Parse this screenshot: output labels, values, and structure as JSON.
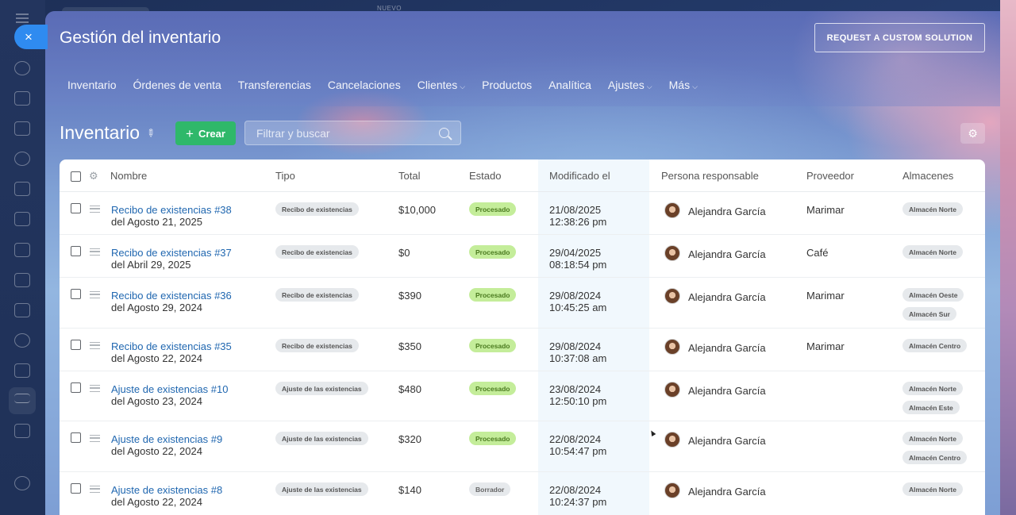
{
  "window": {
    "new_tag": "NUEVO",
    "close_label": "×"
  },
  "header": {
    "title": "Gestión del inventario",
    "custom_button": "REQUEST A CUSTOM SOLUTION"
  },
  "nav": [
    {
      "label": "Inventario",
      "caret": false
    },
    {
      "label": "Órdenes de venta",
      "caret": false
    },
    {
      "label": "Transferencias",
      "caret": false
    },
    {
      "label": "Cancelaciones",
      "caret": false
    },
    {
      "label": "Clientes",
      "caret": true
    },
    {
      "label": "Productos",
      "caret": false
    },
    {
      "label": "Analítica",
      "caret": false
    },
    {
      "label": "Ajustes",
      "caret": true
    },
    {
      "label": "Más",
      "caret": true
    }
  ],
  "toolbar": {
    "title": "Inventario",
    "create_label": "Crear",
    "search_placeholder": "Filtrar y buscar"
  },
  "table": {
    "columns": [
      "Nombre",
      "Tipo",
      "Total",
      "Estado",
      "Modificado el",
      "Persona responsable",
      "Proveedor",
      "Almacenes"
    ],
    "rows": [
      {
        "name": "Recibo de existencias #38",
        "date": "del Agosto 21, 2025",
        "type": "Recibo de existencias",
        "total": "$10,000",
        "status": "Procesado",
        "modified_date": "21/08/2025",
        "modified_time": "12:38:26 pm",
        "person": "Alejandra García",
        "supplier": "Marimar",
        "warehouses": [
          "Almacén Norte"
        ]
      },
      {
        "name": "Recibo de existencias #37",
        "date": "del Abril 29, 2025",
        "type": "Recibo de existencias",
        "total": "$0",
        "status": "Procesado",
        "modified_date": "29/04/2025",
        "modified_time": "08:18:54 pm",
        "person": "Alejandra García",
        "supplier": "Café",
        "warehouses": [
          "Almacén Norte"
        ]
      },
      {
        "name": "Recibo de existencias #36",
        "date": "del Agosto 29, 2024",
        "type": "Recibo de existencias",
        "total": "$390",
        "status": "Procesado",
        "modified_date": "29/08/2024",
        "modified_time": "10:45:25 am",
        "person": "Alejandra García",
        "supplier": "Marimar",
        "warehouses": [
          "Almacén Oeste",
          "Almacén Sur"
        ]
      },
      {
        "name": "Recibo de existencias #35",
        "date": "del Agosto 22, 2024",
        "type": "Recibo de existencias",
        "total": "$350",
        "status": "Procesado",
        "modified_date": "29/08/2024",
        "modified_time": "10:37:08 am",
        "person": "Alejandra García",
        "supplier": "Marimar",
        "warehouses": [
          "Almacén Centro"
        ]
      },
      {
        "name": "Ajuste de existencias #10",
        "date": "del Agosto 23, 2024",
        "type": "Ajuste de las existencias",
        "total": "$480",
        "status": "Procesado",
        "modified_date": "23/08/2024",
        "modified_time": "12:50:10 pm",
        "person": "Alejandra García",
        "supplier": "",
        "warehouses": [
          "Almacén Norte",
          "Almacén Este"
        ]
      },
      {
        "name": "Ajuste de existencias #9",
        "date": "del Agosto 22, 2024",
        "type": "Ajuste de las existencias",
        "total": "$320",
        "status": "Procesado",
        "modified_date": "22/08/2024",
        "modified_time": "10:54:47 pm",
        "person": "Alejandra García",
        "supplier": "",
        "warehouses": [
          "Almacén Norte",
          "Almacén Centro"
        ]
      },
      {
        "name": "Ajuste de existencias #8",
        "date": "del Agosto 22, 2024",
        "type": "Ajuste de las existencias",
        "total": "$140",
        "status": "Borrador",
        "modified_date": "22/08/2024",
        "modified_time": "10:24:37 pm",
        "person": "Alejandra García",
        "supplier": "",
        "warehouses": [
          "Almacén Norte"
        ]
      }
    ]
  }
}
